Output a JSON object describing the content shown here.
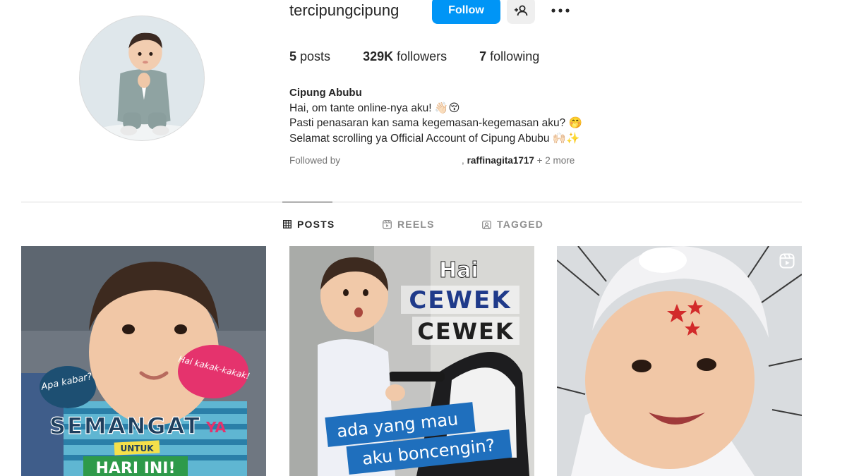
{
  "profile": {
    "username": "tercipungcipung",
    "follow_label": "Follow",
    "add_user_icon": "add-person-icon",
    "more_icon": "more-options-icon"
  },
  "stats": {
    "posts_count": "5",
    "posts_label": "posts",
    "followers_count": "329K",
    "followers_label": "followers",
    "following_count": "7",
    "following_label": "following"
  },
  "bio": {
    "name": "Cipung Abubu",
    "line1": "Hai, om tante online-nya aku! 👋🏻😚",
    "line2": "Pasti penasaran kan sama kegemasan-kegemasan aku? 🤭",
    "line3": "Selamat scrolling ya Official Account of Cipung Abubu 🙌🏻✨",
    "followed_by_label": "Followed by",
    "followed_by_sep": ",",
    "followed_by_user": "raffinagita1717",
    "followed_by_more": "+ 2 more"
  },
  "tabs": [
    {
      "label": "POSTS",
      "icon": "grid-icon",
      "active": true
    },
    {
      "label": "REELS",
      "icon": "reels-icon",
      "active": false
    },
    {
      "label": "TAGGED",
      "icon": "tagged-icon",
      "active": false
    }
  ],
  "posts": [
    {
      "bubble_left": "Apa kabar?",
      "bubble_right": "Hai kakak-kakak!",
      "headline": "SEMANGAT",
      "headline_suffix": "YA",
      "sub": "UNTUK",
      "footer": "HARI INI!"
    },
    {
      "top": "Hai",
      "word1": "CEWEK",
      "word2": "CEWEK",
      "line1": "ada yang mau",
      "line2": "aku boncengin?"
    },
    {
      "badge_icon": "reel-icon"
    }
  ],
  "colors": {
    "accent": "#0095f6",
    "text": "#262626",
    "muted": "#737373",
    "divider": "#dbdbdb"
  }
}
